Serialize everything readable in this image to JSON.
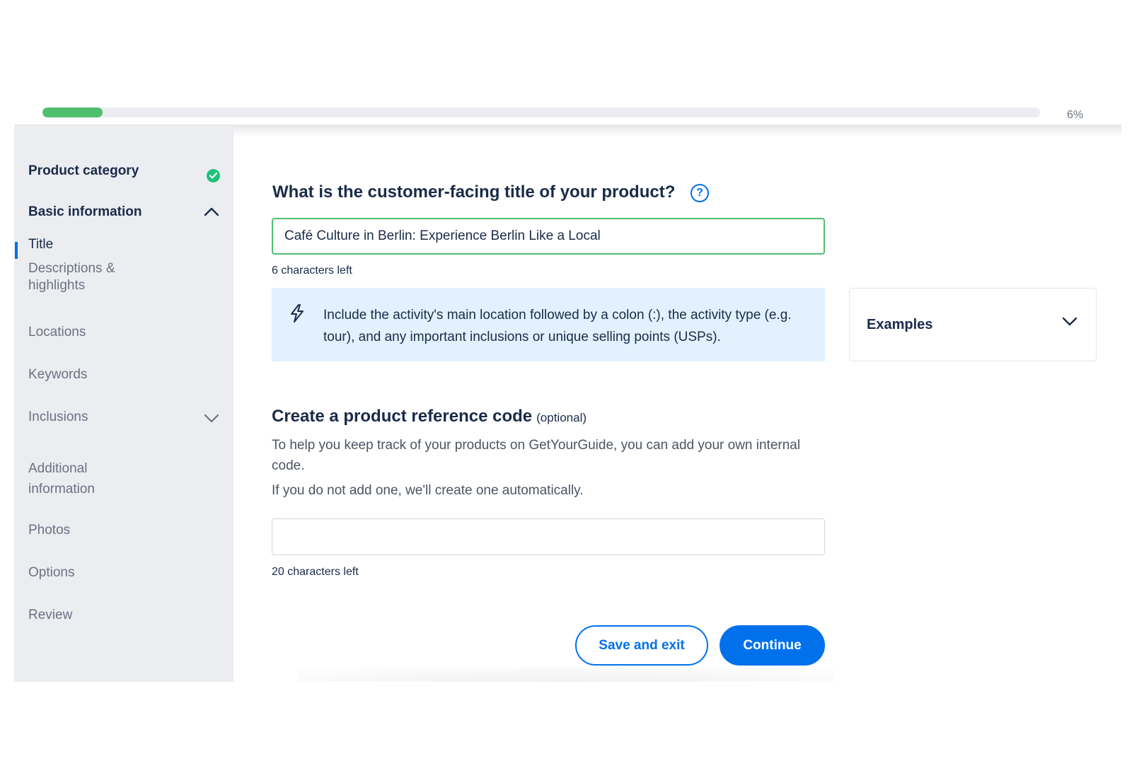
{
  "progress": {
    "value": 0.06,
    "label": "6%"
  },
  "sidebar": {
    "items": [
      {
        "label": "Product category",
        "status": "complete"
      },
      {
        "label": "Basic information",
        "expanded": true
      },
      {
        "label": "Title",
        "active": true
      },
      {
        "label": "Descriptions & highlights"
      },
      {
        "label": "Locations"
      },
      {
        "label": "Keywords"
      },
      {
        "label": "Inclusions",
        "expandable": true
      },
      {
        "label": "Additional information"
      },
      {
        "label": "Photos"
      },
      {
        "label": "Options"
      },
      {
        "label": "Review"
      }
    ]
  },
  "title_section": {
    "question": "What is the customer-facing title of your product?",
    "help_icon": "question-circle-icon",
    "input_value": "Café Culture in Berlin: Experience Berlin Like a Local",
    "chars_left": "6 characters left",
    "tip": "Include the activity's main location followed by a colon (:), the activity type (e.g. tour), and any important inclusions or unique selling points (USPs).",
    "tip_icon": "lightning-icon",
    "examples_label": "Examples"
  },
  "ref_section": {
    "title": "Create a product reference code",
    "optional": "(optional)",
    "desc1": "To help you keep track of your products on GetYourGuide, you can add your own internal code.",
    "desc2": "If you do not add one, we'll create one automatically.",
    "input_value": "",
    "chars_left": "20 characters left"
  },
  "actions": {
    "save_label": "Save and exit",
    "continue_label": "Continue"
  },
  "colors": {
    "accent": "#0071eb",
    "success": "#4fbf6f",
    "sidebar_bg": "#ebedf1",
    "tip_bg": "#e2f1fd"
  }
}
